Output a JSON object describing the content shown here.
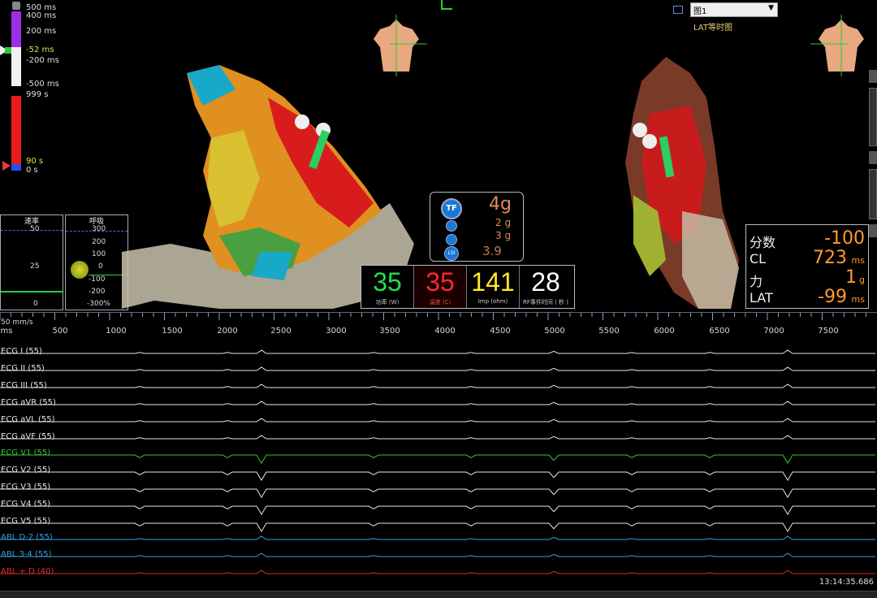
{
  "top_scale": {
    "labels": [
      "500 ms",
      "400 ms",
      "200 ms",
      "-52 ms",
      "-200 ms",
      "-500 ms",
      "999 s",
      "90 s",
      "0 s"
    ]
  },
  "rate_panel": {
    "title": "速率",
    "ticks": [
      "50",
      "25",
      "0"
    ]
  },
  "resp_panel": {
    "title": "呼吸",
    "ticks": [
      "300",
      "200",
      "100",
      "0",
      "-100",
      "-200",
      "-300%"
    ]
  },
  "map_selector": {
    "value": "图1",
    "subtitle": "LAT等时图"
  },
  "contact": {
    "tf_label": "TF",
    "tf_value": "4g",
    "axial_value": "2 g",
    "lateral_value": "3 g",
    "lsi_label": "LSI",
    "lsi_value": "3.9"
  },
  "ablation": [
    {
      "value": "35",
      "label": "功率 (W)",
      "color": "#22e04a"
    },
    {
      "value": "35",
      "label": "温度 (C)",
      "color": "#ff2a2a"
    },
    {
      "value": "141",
      "label": "Imp (ohm)",
      "color": "#ffe82a"
    },
    {
      "value": "28",
      "label": "RF事件时间 ( 秒 )",
      "color": "#ffffff"
    }
  ],
  "info_panel": {
    "rows": [
      {
        "label": "分数",
        "value": "-100",
        "unit": ""
      },
      {
        "label": "CL",
        "value": "723",
        "unit": "ms"
      },
      {
        "label": "力",
        "value": "1",
        "unit": "g"
      },
      {
        "label": "LAT",
        "value": "-99",
        "unit": "ms"
      }
    ],
    "value_color": "#ff9a2a"
  },
  "timeline": {
    "speed": "50 mm/s",
    "ticks": [
      "ms",
      "500",
      "1000",
      "1500",
      "2000",
      "2500",
      "3000",
      "3500",
      "4000",
      "4500",
      "5000",
      "5500",
      "6000",
      "6500",
      "7000",
      "7500"
    ]
  },
  "leads": [
    {
      "label": "ECG I (55)",
      "color": "#e6e6e6"
    },
    {
      "label": "ECG II (55)",
      "color": "#e6e6e6"
    },
    {
      "label": "ECG III (55)",
      "color": "#e6e6e6"
    },
    {
      "label": "ECG aVR (55)",
      "color": "#e6e6e6"
    },
    {
      "label": "ECG aVL (55)",
      "color": "#e6e6e6"
    },
    {
      "label": "ECG aVF (55)",
      "color": "#e6e6e6"
    },
    {
      "label": "ECG V1 (55)",
      "color": "#35c835"
    },
    {
      "label": "ECG V2 (55)",
      "color": "#e6e6e6"
    },
    {
      "label": "ECG V3 (55)",
      "color": "#e6e6e6"
    },
    {
      "label": "ECG V4 (55)",
      "color": "#e6e6e6"
    },
    {
      "label": "ECG V5 (55)",
      "color": "#e6e6e6"
    },
    {
      "label": "ABL  D-2 (55)",
      "color": "#3aa0e0"
    },
    {
      "label": "ABL  3-4 (55)",
      "color": "#3aa0e0"
    },
    {
      "label": "ABL  + D (40)",
      "color": "#e02a2a"
    }
  ],
  "clock": "13:14:35.686"
}
